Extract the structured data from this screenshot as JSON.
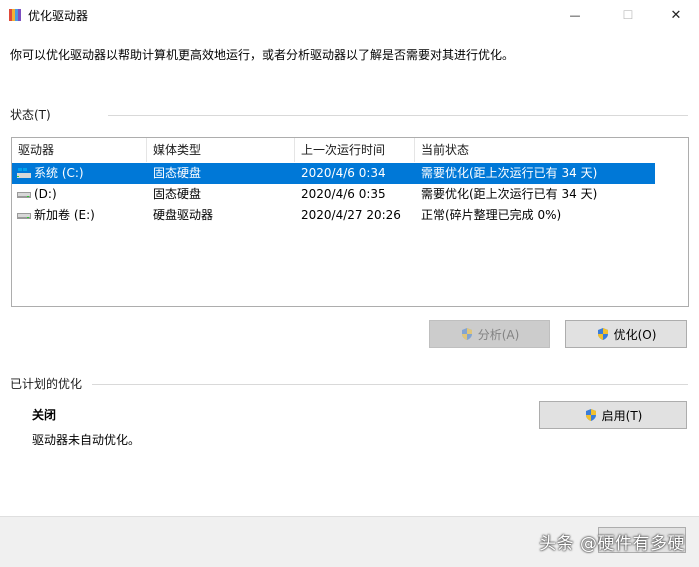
{
  "window": {
    "title": "优化驱动器",
    "minimize_symbol": "—",
    "maximize_symbol": "☐",
    "close_symbol": "✕"
  },
  "intro_text": "你可以优化驱动器以帮助计算机更高效地运行，或者分析驱动器以了解是否需要对其进行优化。",
  "status": {
    "label": "状态(T)",
    "columns": [
      "驱动器",
      "媒体类型",
      "上一次运行时间",
      "当前状态"
    ],
    "rows": [
      {
        "drive": "系统 (C:)",
        "media": "固态硬盘",
        "last_run": "2020/4/6 0:34",
        "state": "需要优化(距上次运行已有 34 天)",
        "selected": true,
        "icon": "windows-drive-icon"
      },
      {
        "drive": "(D:)",
        "media": "固态硬盘",
        "last_run": "2020/4/6 0:35",
        "state": "需要优化(距上次运行已有 34 天)",
        "selected": false,
        "icon": "drive-icon"
      },
      {
        "drive": "新加卷 (E:)",
        "media": "硬盘驱动器",
        "last_run": "2020/4/27 20:26",
        "state": "正常(碎片整理已完成 0%)",
        "selected": false,
        "icon": "drive-icon"
      }
    ]
  },
  "buttons": {
    "analyze": "分析(A)",
    "optimize": "优化(O)",
    "enable": "启用(T)"
  },
  "scheduled": {
    "label": "已计划的优化",
    "state": "关闭",
    "description": "驱动器未自动优化。"
  },
  "watermark": "头条 @硬件有多硬",
  "colors": {
    "selection": "#0078d7",
    "footer": "#f0f0f0",
    "disabled_button": "#cccccc"
  }
}
